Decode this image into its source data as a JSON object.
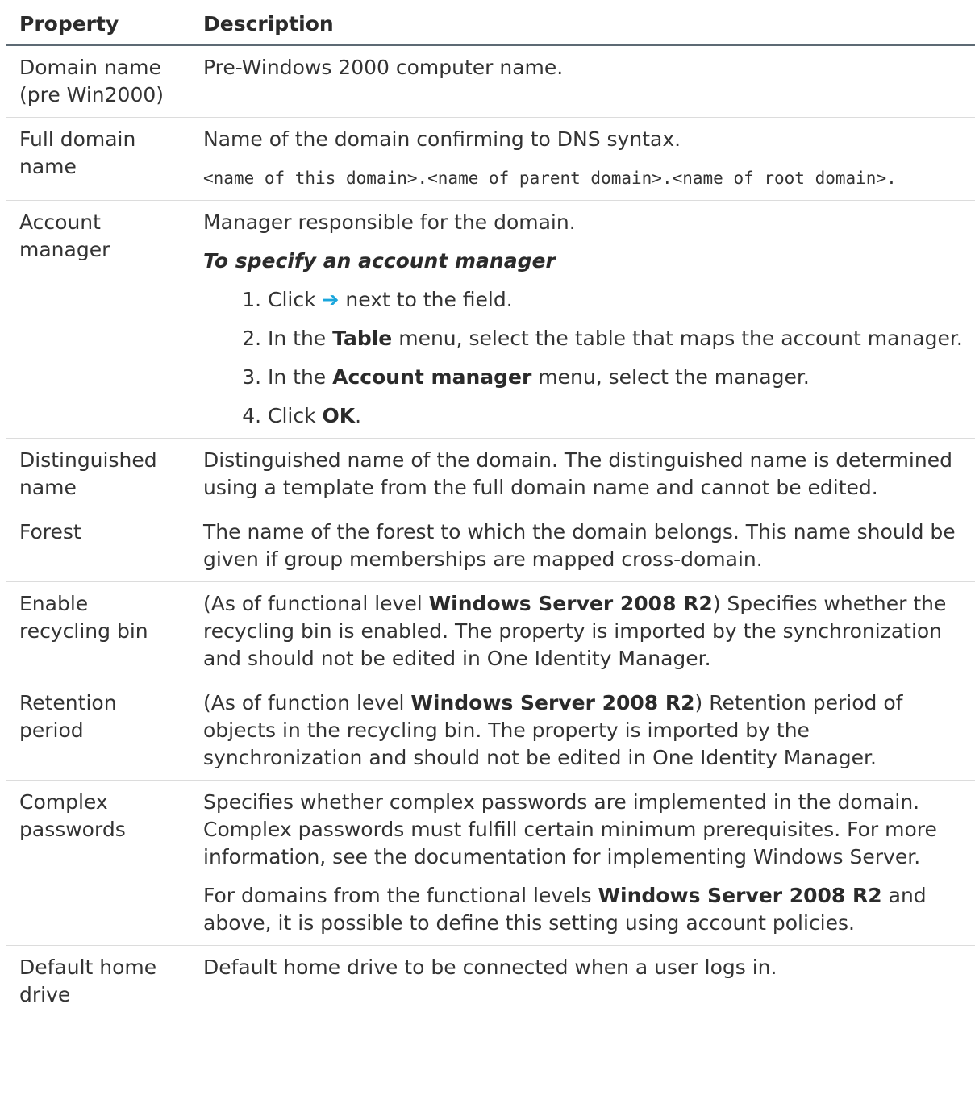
{
  "header": {
    "property": "Property",
    "description": "Description"
  },
  "rows": {
    "r0": {
      "property": "Domain name (pre Win2000)",
      "desc": "Pre-Windows 2000 computer name."
    },
    "r1": {
      "property": "Full domain name",
      "desc": "Name of the domain confirming to DNS syntax.",
      "code": "<name of this domain>.<name of parent domain>.<name of root domain>."
    },
    "r2": {
      "property": "Account manager",
      "desc": "Manager responsible for the domain.",
      "procedure_title": "To specify an account manager",
      "steps": {
        "s1": {
          "pre": "Click ",
          "icon": "arrow-right-icon",
          "glyph": "➔",
          "post": " next to the field."
        },
        "s2": {
          "pre": "In the ",
          "bold": "Table",
          "post": " menu, select the table that maps the account manager."
        },
        "s3": {
          "pre": "In the ",
          "bold": "Account manager",
          "post": " menu, select the manager."
        },
        "s4": {
          "pre": "Click ",
          "bold": "OK",
          "post": "."
        }
      }
    },
    "r3": {
      "property": "Distinguished name",
      "desc": "Distinguished name of the domain. The distinguished name is determined using a template from the full domain name and cannot be edited."
    },
    "r4": {
      "property": "Forest",
      "desc": "The name of the forest to which the domain belongs. This name should be given if group memberships are mapped cross-domain."
    },
    "r5": {
      "property": "Enable recycling bin",
      "pre": "(As of functional level ",
      "bold": "Windows Server 2008 R2",
      "post": ") Specifies whether the recycling bin is enabled. The property is imported by the synchronization and should not be edited in One Identity Manager."
    },
    "r6": {
      "property": "Retention period",
      "pre": "(As of function level ",
      "bold": "Windows Server 2008 R2",
      "post": ") Retention period of objects in the recycling bin. The property is imported by the synchronization and should not be edited in One Identity Manager."
    },
    "r7": {
      "property": "Complex passwords",
      "desc": "Specifies whether complex passwords are implemented in the domain. Complex passwords must fulfill certain minimum prerequisites. For more information, see the documentation for implementing Windows Server.",
      "p2_pre": "For domains from the functional levels ",
      "p2_bold": "Windows Server 2008 R2",
      "p2_post": " and above, it is possible to define this setting using account policies."
    },
    "r8": {
      "property": "Default home drive",
      "desc": "Default home drive to be connected when a user logs in."
    }
  },
  "colors": {
    "text": "#333333",
    "header_rule": "#5d6a74",
    "row_rule": "#dcdcdc",
    "arrow": "#1aa6dc"
  }
}
